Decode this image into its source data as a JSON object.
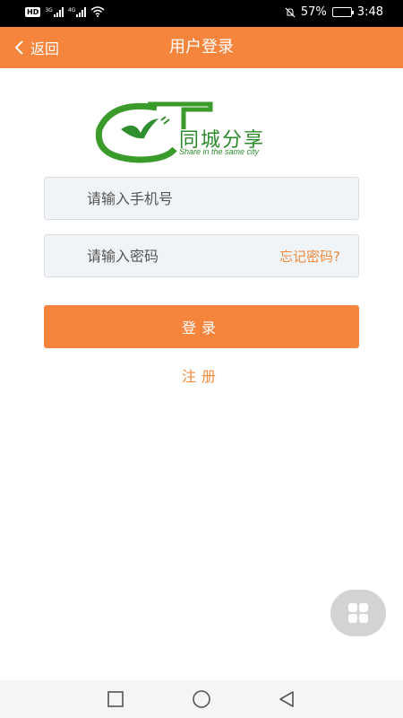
{
  "status_bar": {
    "left_badge": "HD",
    "network_1": "3G",
    "network_2": "4G",
    "battery_percent": "57%",
    "battery_level": 0.57,
    "time": "3:48"
  },
  "header": {
    "back_label": "返回",
    "title": "用户登录"
  },
  "logo": {
    "text": "同城分享",
    "subtitle": "Share in the same city"
  },
  "form": {
    "phone_placeholder": "请输入手机号",
    "password_placeholder": "请输入密码",
    "forgot_label": "忘记密码?",
    "login_label": "登录",
    "register_label": "注册"
  },
  "icons": {
    "back": "chevron-left-icon",
    "floating": "grid-icon",
    "nav_recent": "square-icon",
    "nav_home": "circle-icon",
    "nav_back": "triangle-left-icon"
  },
  "colors": {
    "accent": "#f5853d",
    "link": "#f08a3c",
    "input_bg": "#f1f4f7",
    "logo_green": "#2b8a2b"
  }
}
